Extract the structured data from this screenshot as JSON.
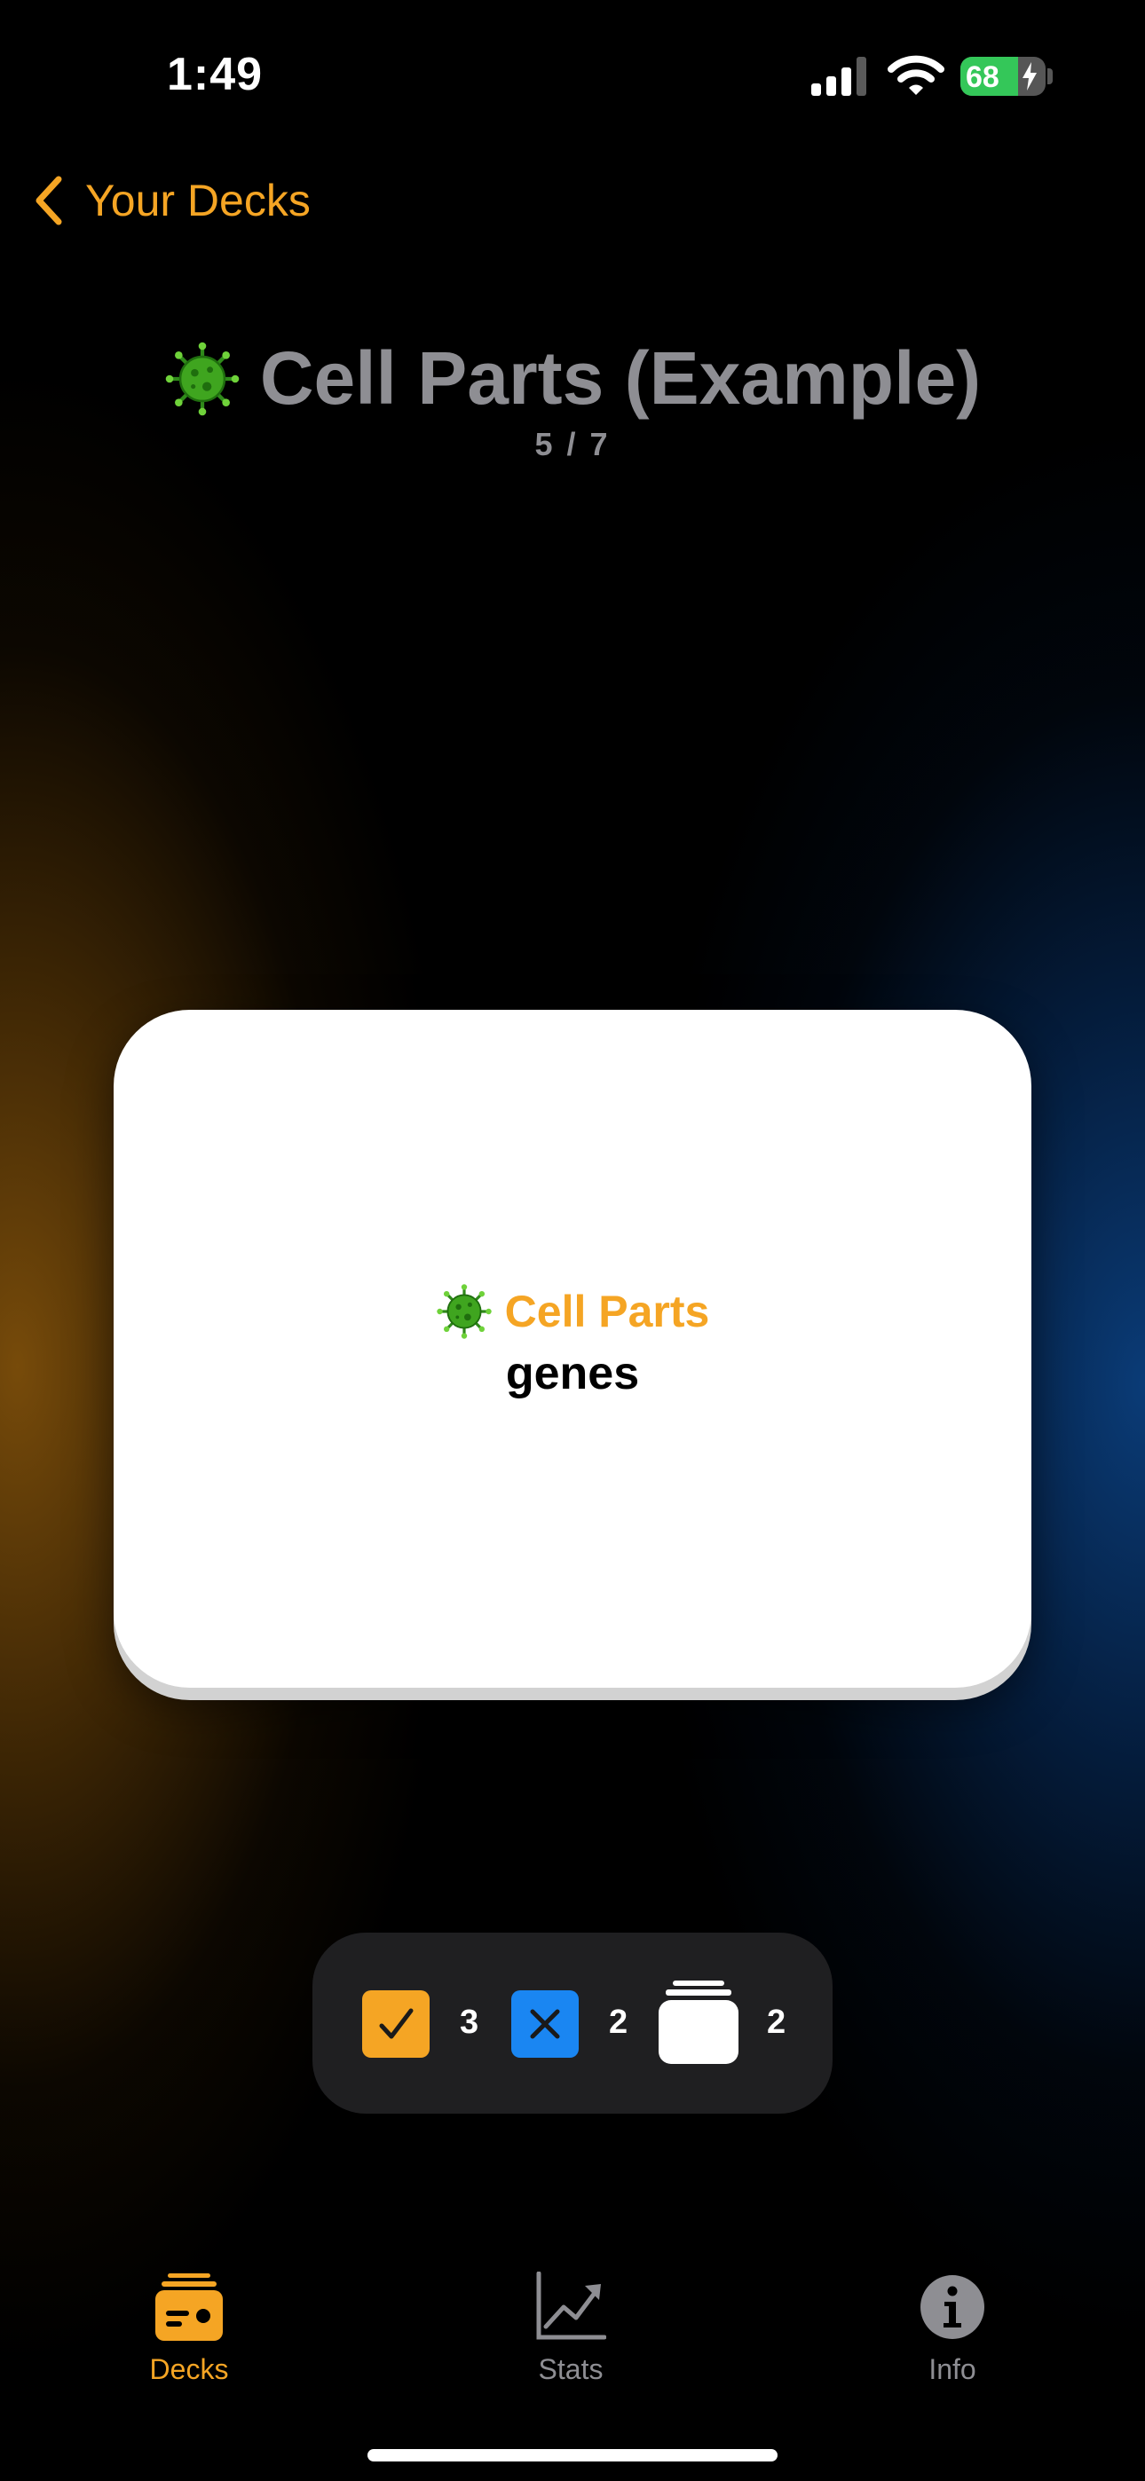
{
  "status_bar": {
    "time": "1:49",
    "battery_level": 68,
    "battery_charging": true,
    "icons": [
      "signal-icon",
      "wifi-icon",
      "battery-icon"
    ]
  },
  "nav": {
    "back_label": "Your Decks",
    "back_icon": "chevron-left-icon"
  },
  "header": {
    "icon": "microbe-icon",
    "title": "Cell Parts (Example)",
    "progress": "5 / 7"
  },
  "card": {
    "deck_icon": "microbe-icon",
    "deck_name": "Cell Parts",
    "term": "genes"
  },
  "session_stats": {
    "correct_count": "3",
    "wrong_count": "2",
    "remaining_count": "2",
    "icons": [
      "checkmark-icon",
      "xmark-icon",
      "card-stack-icon"
    ]
  },
  "tab_bar": {
    "active": "decks",
    "tabs": [
      {
        "id": "decks",
        "label": "Decks",
        "icon": "decks-icon"
      },
      {
        "id": "stats",
        "label": "Stats",
        "icon": "chart-icon"
      },
      {
        "id": "info",
        "label": "Info",
        "icon": "info-icon"
      }
    ]
  },
  "colors": {
    "accent": "#f5a524",
    "correct": "#f5a524",
    "wrong": "#1a86f2",
    "muted": "#8e8e93",
    "battery": "#34c759",
    "background": "#000000"
  }
}
